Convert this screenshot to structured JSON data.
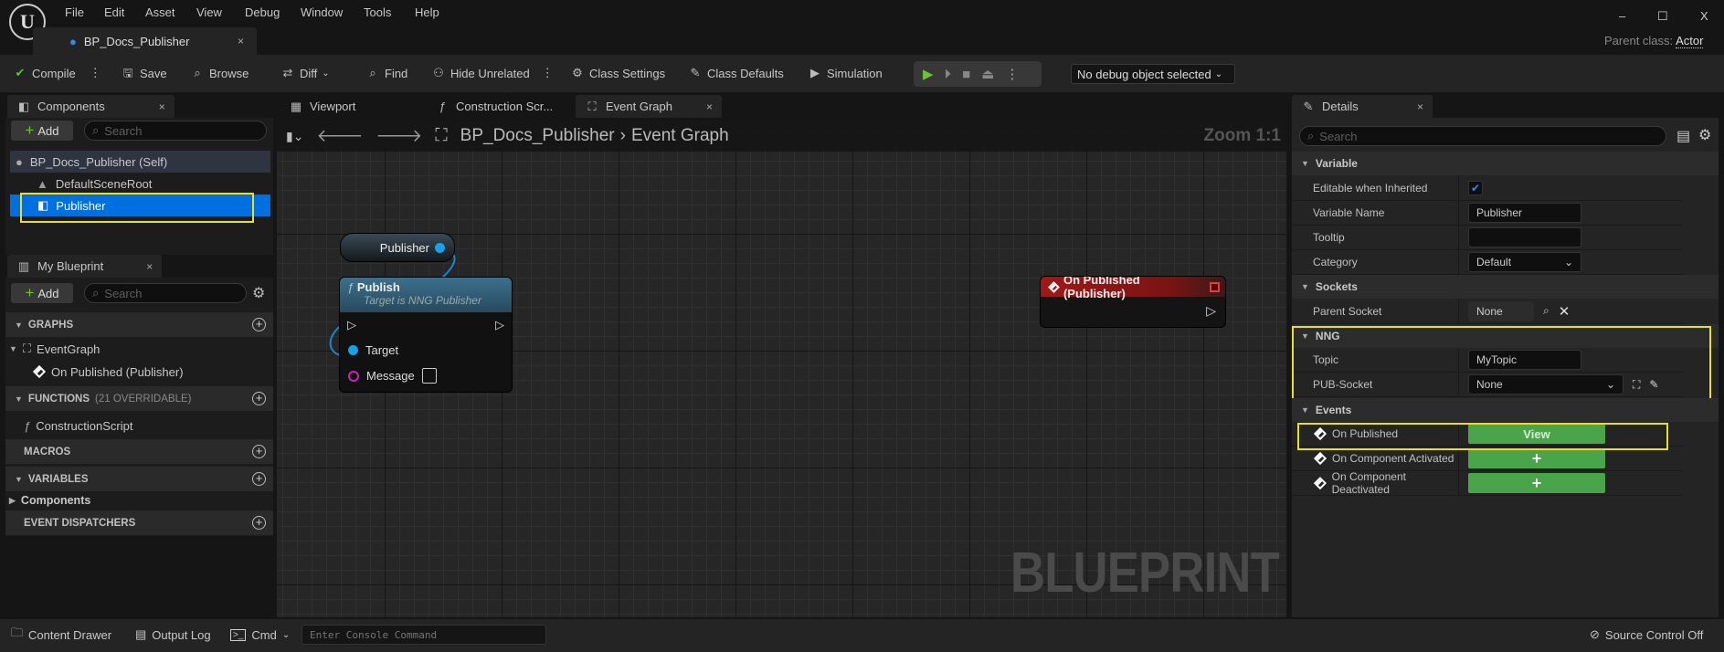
{
  "menu": [
    "File",
    "Edit",
    "Asset",
    "View",
    "Debug",
    "Window",
    "Tools",
    "Help"
  ],
  "document_tab": "BP_Docs_Publisher",
  "window_controls": {
    "minimize": "–",
    "maximize": "☐",
    "close": "X"
  },
  "parent_class": {
    "label": "Parent class:",
    "value": "Actor"
  },
  "toolbar": {
    "compile": "Compile",
    "save": "Save",
    "browse": "Browse",
    "diff": "Diff",
    "find": "Find",
    "hide_unrelated": "Hide Unrelated",
    "class_settings": "Class Settings",
    "class_defaults": "Class Defaults",
    "simulation": "Simulation",
    "debug_object": "No debug object selected"
  },
  "components": {
    "tab": "Components",
    "add": "Add",
    "search_placeholder": "Search",
    "tree": [
      "BP_Docs_Publisher (Self)",
      "DefaultSceneRoot",
      "Publisher"
    ],
    "selected": "Publisher"
  },
  "my_blueprint": {
    "tab": "My Blueprint",
    "add": "Add",
    "search_placeholder": "Search",
    "sections": {
      "graphs": "GRAPHS",
      "functions": "FUNCTIONS",
      "functions_count": "(21 OVERRIDABLE)",
      "macros": "MACROS",
      "variables": "VARIABLES",
      "event_dispatchers": "EVENT DISPATCHERS"
    },
    "graphs": [
      "EventGraph",
      "On Published (Publisher)"
    ],
    "functions": [
      "ConstructionScript"
    ],
    "variables": [
      "Components"
    ]
  },
  "editor_tabs": [
    "Viewport",
    "Construction Scr...",
    "Event Graph"
  ],
  "graph": {
    "breadcrumb": [
      "BP_Docs_Publisher",
      "Event Graph"
    ],
    "zoom": "Zoom 1:1",
    "watermark": "BLUEPRINT",
    "nodes": {
      "variable": "Publisher",
      "publish": {
        "title": "Publish",
        "subtitle": "Target is NNG Publisher",
        "pins": [
          "Target",
          "Message"
        ]
      },
      "event": "On Published (Publisher)"
    }
  },
  "details": {
    "tab": "Details",
    "search_placeholder": "Search",
    "variable": {
      "section": "Variable",
      "editable_label": "Editable when Inherited",
      "editable_checked": true,
      "name_label": "Variable Name",
      "name_value": "Publisher",
      "tooltip_label": "Tooltip",
      "tooltip_value": "",
      "category_label": "Category",
      "category_value": "Default"
    },
    "sockets": {
      "section": "Sockets",
      "parent_label": "Parent Socket",
      "parent_value": "None"
    },
    "nng": {
      "section": "NNG",
      "topic_label": "Topic",
      "topic_value": "MyTopic",
      "socket_label": "PUB-Socket",
      "socket_value": "None"
    },
    "events": {
      "section": "Events",
      "items": [
        "On Published",
        "On Component Activated",
        "On Component Deactivated"
      ],
      "view": "View",
      "add": "+"
    }
  },
  "statusbar": {
    "content_drawer": "Content Drawer",
    "output_log": "Output Log",
    "cmd": "Cmd",
    "console_placeholder": "Enter Console Command",
    "source_control": "Source Control Off"
  },
  "colors": {
    "accent_selected": "#0070e0",
    "highlight": "#e8e020",
    "green_button": "#4aa44a",
    "event_node": "#a01818",
    "function_node": "#3b6a86",
    "pin_object": "#1aa0e8",
    "pin_string": "#d020c0"
  }
}
